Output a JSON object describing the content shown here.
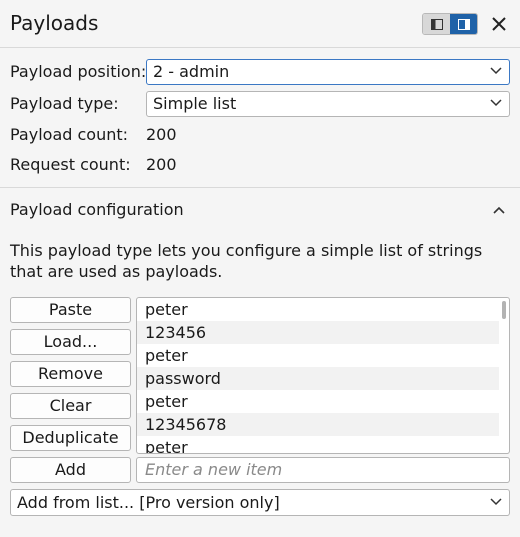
{
  "header": {
    "title": "Payloads",
    "layout_icons": [
      "panel-left-icon",
      "panel-right-icon"
    ],
    "close_icon": "close-icon"
  },
  "settings": {
    "position_label": "Payload position:",
    "position_value": "2 - admin",
    "type_label": "Payload type:",
    "type_value": "Simple list",
    "count_label": "Payload count:",
    "count_value": "200",
    "request_label": "Request count:",
    "request_value": "200"
  },
  "config": {
    "title": "Payload configuration",
    "description": "This payload type lets you configure a simple list of strings that are used as payloads.",
    "buttons": {
      "paste": "Paste",
      "load": "Load...",
      "remove": "Remove",
      "clear": "Clear",
      "deduplicate": "Deduplicate",
      "add": "Add"
    },
    "items": [
      "peter",
      "123456",
      "peter",
      "password",
      "peter",
      "12345678",
      "peter"
    ],
    "new_item_placeholder": "Enter a new item",
    "add_from_list": "Add from list... [Pro version only]"
  },
  "colors": {
    "accent": "#1f62a8",
    "focus_border": "#3b78c4"
  }
}
